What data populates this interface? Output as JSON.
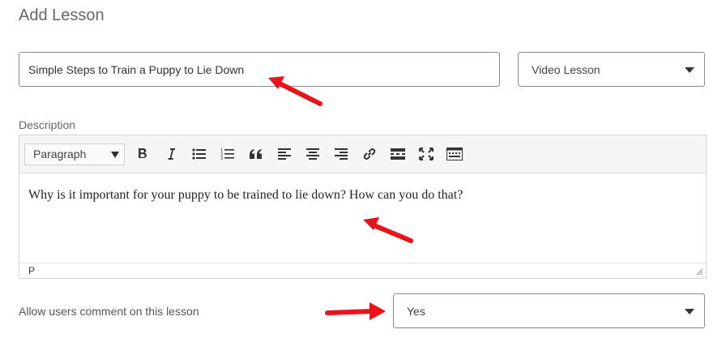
{
  "page": {
    "title": "Add Lesson"
  },
  "lesson": {
    "title_value": "Simple Steps to Train a Puppy to Lie Down",
    "type_selected": "Video Lesson"
  },
  "description": {
    "label": "Description",
    "format_selected": "Paragraph",
    "body_text": "Why is it important for your puppy to be trained to lie down? How can you do that?",
    "status_path": "P"
  },
  "toolbar": {
    "icons": [
      "bold-icon",
      "italic-icon",
      "bullet-list-icon",
      "numbered-list-icon",
      "blockquote-icon",
      "align-left-icon",
      "align-center-icon",
      "align-right-icon",
      "link-icon",
      "read-more-icon",
      "fullscreen-icon",
      "toolbar-toggle-icon"
    ]
  },
  "comments": {
    "label": "Allow users comment on this lesson",
    "selected": "Yes"
  },
  "colors": {
    "arrow": "#e8141b",
    "border": "#8a8a8a",
    "toolbar_bg": "#f5f5f5"
  }
}
